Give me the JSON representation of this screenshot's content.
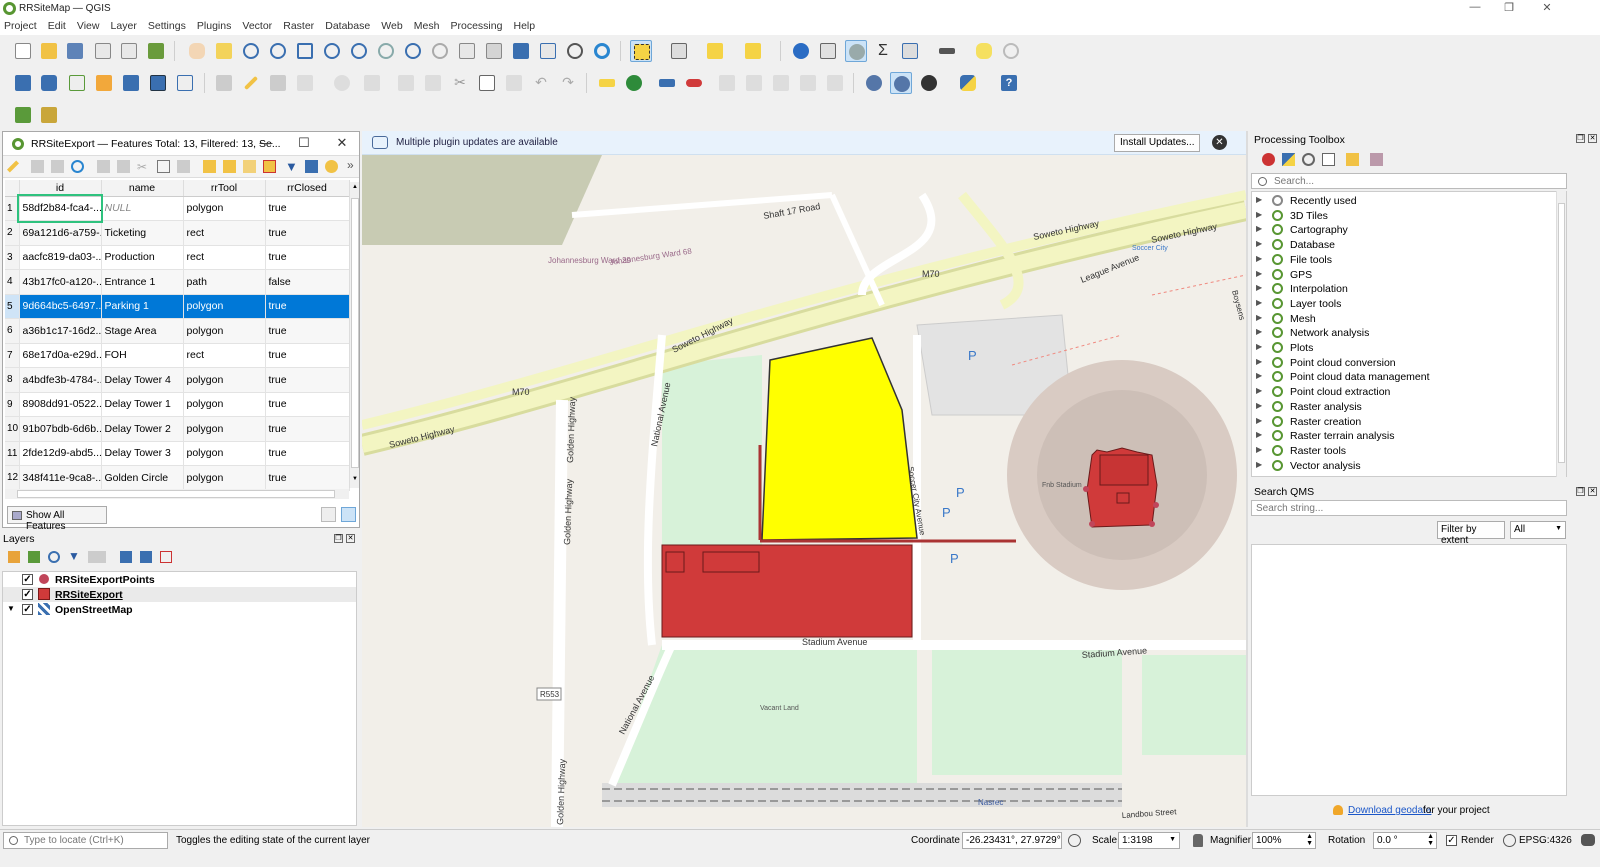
{
  "window": {
    "title": "RRSiteMap — QGIS"
  },
  "menubar": [
    "Project",
    "Edit",
    "View",
    "Layer",
    "Settings",
    "Plugins",
    "Vector",
    "Raster",
    "Database",
    "Web",
    "Mesh",
    "Processing",
    "Help"
  ],
  "attribute_table": {
    "title": "RRSiteExport — Features Total: 13, Filtered: 13, Se...",
    "columns": [
      "id",
      "name",
      "rrTool",
      "rrClosed"
    ],
    "rows": [
      {
        "n": "1",
        "id": "58df2b84-fca4-...",
        "name": "NULL",
        "tool": "polygon",
        "closed": "true"
      },
      {
        "n": "2",
        "id": "69a121d6-a759-...",
        "name": "Ticketing",
        "tool": "rect",
        "closed": "true"
      },
      {
        "n": "3",
        "id": "aacfc819-da03-...",
        "name": "Production",
        "tool": "rect",
        "closed": "true"
      },
      {
        "n": "4",
        "id": "43b17fc0-a120-...",
        "name": "Entrance 1",
        "tool": "path",
        "closed": "false"
      },
      {
        "n": "5",
        "id": "9d664bc5-6497...",
        "name": "Parking 1",
        "tool": "polygon",
        "closed": "true"
      },
      {
        "n": "6",
        "id": "a36b1c17-16d2...",
        "name": "Stage Area",
        "tool": "polygon",
        "closed": "true"
      },
      {
        "n": "7",
        "id": "68e17d0a-e29d...",
        "name": "FOH",
        "tool": "rect",
        "closed": "true"
      },
      {
        "n": "8",
        "id": "a4bdfe3b-4784-...",
        "name": "Delay Tower 4",
        "tool": "polygon",
        "closed": "true"
      },
      {
        "n": "9",
        "id": "8908dd91-0522...",
        "name": "Delay Tower 1",
        "tool": "polygon",
        "closed": "true"
      },
      {
        "n": "10",
        "id": "91b07bdb-6d6b...",
        "name": "Delay Tower 2",
        "tool": "polygon",
        "closed": "true"
      },
      {
        "n": "11",
        "id": "2fde12d9-abd5...",
        "name": "Delay Tower 3",
        "tool": "polygon",
        "closed": "true"
      },
      {
        "n": "12",
        "id": "348f411e-9ca8-...",
        "name": "Golden Circle",
        "tool": "polygon",
        "closed": "true"
      }
    ],
    "selected_row": 4,
    "show_all_label": "Show All Features"
  },
  "layers_panel": {
    "title": "Layers",
    "layers": [
      {
        "name": "RRSiteExportPoints",
        "checked": true,
        "color": "#c0455a"
      },
      {
        "name": "RRSiteExport",
        "checked": true,
        "color": "#d03a3a"
      },
      {
        "name": "OpenStreetMap",
        "checked": true,
        "color": "#3a6fb0"
      }
    ]
  },
  "message_bar": {
    "text": "Multiple plugin updates are available",
    "button": "Install Updates..."
  },
  "processing_toolbox": {
    "title": "Processing Toolbox",
    "search_placeholder": "Search...",
    "items": [
      "Recently used",
      "3D Tiles",
      "Cartography",
      "Database",
      "File tools",
      "GPS",
      "Interpolation",
      "Layer tools",
      "Mesh",
      "Network analysis",
      "Plots",
      "Point cloud conversion",
      "Point cloud data management",
      "Point cloud extraction",
      "Raster analysis",
      "Raster creation",
      "Raster terrain analysis",
      "Raster tools",
      "Vector analysis"
    ]
  },
  "search_qms": {
    "title": "Search QMS",
    "placeholder": "Search string...",
    "filter_button": "Filter by extent",
    "filter_value": "All",
    "download_link": "Download geodata",
    "download_suffix": " for your project"
  },
  "map": {
    "labels": {
      "shaft": "Shaft 17 Road",
      "soweto1": "Soweto Highway",
      "soweto2": "Soweto Highway",
      "soweto3": "Soweto Highway",
      "soweto4": "Soweto Highway",
      "league": "League Avenue",
      "m70a": "M70",
      "m70b": "M70",
      "ward68": "Johannesburg Ward 68",
      "ward29": "Johannesburg Ward 29",
      "national1": "National Avenue",
      "national2": "National Avenue",
      "golden1": "Golden Highway",
      "golden2": "Golden Highway",
      "golden3": "Golden Highway",
      "stadium1": "Stadium Avenue",
      "stadium2": "Stadium Avenue",
      "soccer": "Soccer City",
      "fnb": "Fnb Stadium",
      "vacant": "Vacant Land",
      "nasrec": "Nasrec",
      "r553": "R553",
      "landbou": "Landbou Street",
      "soccercity": "Soccer City Avenue",
      "boysens": "Boysens"
    }
  },
  "statusbar": {
    "locate_placeholder": "Type to locate (Ctrl+K)",
    "message": "Toggles the editing state of the current layer",
    "coordinate_label": "Coordinate",
    "coordinate": "-26.23431°, 27.9729°",
    "scale_label": "Scale",
    "scale": "1:3198",
    "magnifier_label": "Magnifier",
    "magnifier": "100%",
    "rotation_label": "Rotation",
    "rotation": "0.0 °",
    "render_label": "Render",
    "crs": "EPSG:4326"
  }
}
